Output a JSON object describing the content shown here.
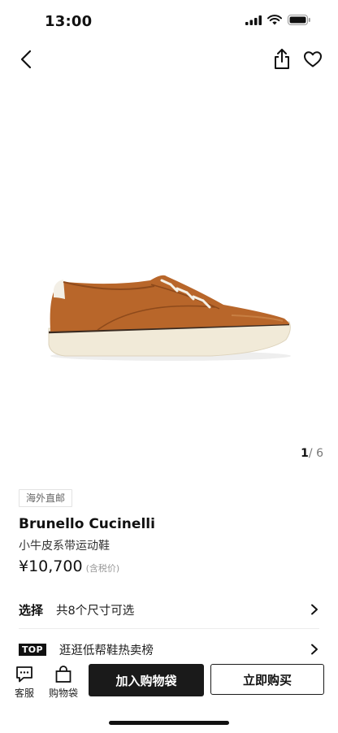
{
  "status_bar": {
    "time": "13:00"
  },
  "nav": {
    "back_icon": "chevron-left-icon",
    "share_icon": "share-icon",
    "favorite_icon": "heart-icon"
  },
  "gallery": {
    "current": "1",
    "total": "6",
    "separator": "/"
  },
  "product": {
    "tag": "海外直邮",
    "brand": "Brunello Cucinelli",
    "name": "小牛皮系带运动鞋",
    "price": "¥10,700",
    "tax_note": "(含税价)"
  },
  "size_row": {
    "label": "选择",
    "text": "共8个尺寸可选"
  },
  "ranking_row": {
    "badge": "TOP",
    "text": "逛逛低帮鞋热卖榜"
  },
  "bottom_bar": {
    "service_label": "客服",
    "bag_label": "购物袋",
    "add_to_bag": "加入购物袋",
    "buy_now": "立即购买"
  }
}
